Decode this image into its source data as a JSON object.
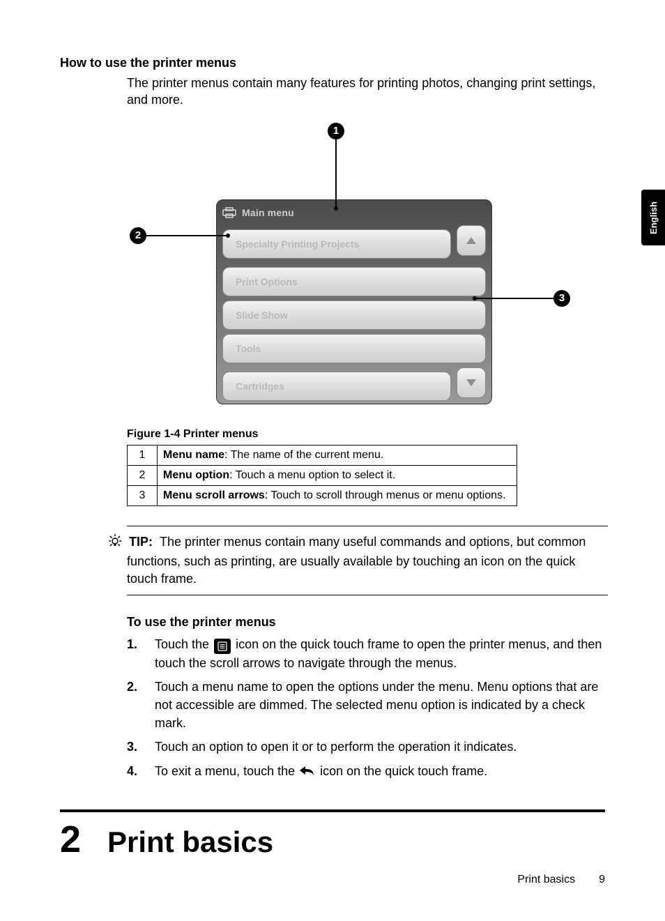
{
  "side_tab": "English",
  "section_heading": "How to use the printer menus",
  "intro": "The printer menus contain many features for printing photos, changing print settings, and more.",
  "callouts": {
    "c1": "1",
    "c2": "2",
    "c3": "3"
  },
  "screen": {
    "title": "Main menu",
    "items": [
      "Specialty Printing Projects",
      "Print Options",
      "Slide Show",
      "Tools",
      "Cartridges"
    ]
  },
  "figure_caption": "Figure 1-4 Printer menus",
  "legend": [
    {
      "n": "1",
      "label_bold": "Menu name",
      "label_rest": ": The name of the current menu."
    },
    {
      "n": "2",
      "label_bold": "Menu option",
      "label_rest": ": Touch a menu option to select it."
    },
    {
      "n": "3",
      "label_bold": "Menu scroll arrows",
      "label_rest": ": Touch to scroll through menus or menu options."
    }
  ],
  "tip": {
    "label": "TIP:",
    "text": "The printer menus contain many useful commands and options, but common functions, such as printing, are usually available by touching an icon on the quick touch frame."
  },
  "sub_heading": "To use the printer menus",
  "steps": [
    {
      "n": "1.",
      "pre": "Touch the ",
      "icon": "menu",
      "post": " icon on the quick touch frame to open the printer menus, and then touch the scroll arrows to navigate through the menus."
    },
    {
      "n": "2.",
      "text": "Touch a menu name to open the options under the menu. Menu options that are not accessible are dimmed. The selected menu option is indicated by a check mark."
    },
    {
      "n": "3.",
      "text": "Touch an option to open it or to perform the operation it indicates."
    },
    {
      "n": "4.",
      "pre": "To exit a menu, touch the ",
      "icon": "back",
      "post": " icon on the quick touch frame."
    }
  ],
  "chapter": {
    "num": "2",
    "title": "Print basics"
  },
  "footer": {
    "section": "Print basics",
    "page": "9"
  }
}
